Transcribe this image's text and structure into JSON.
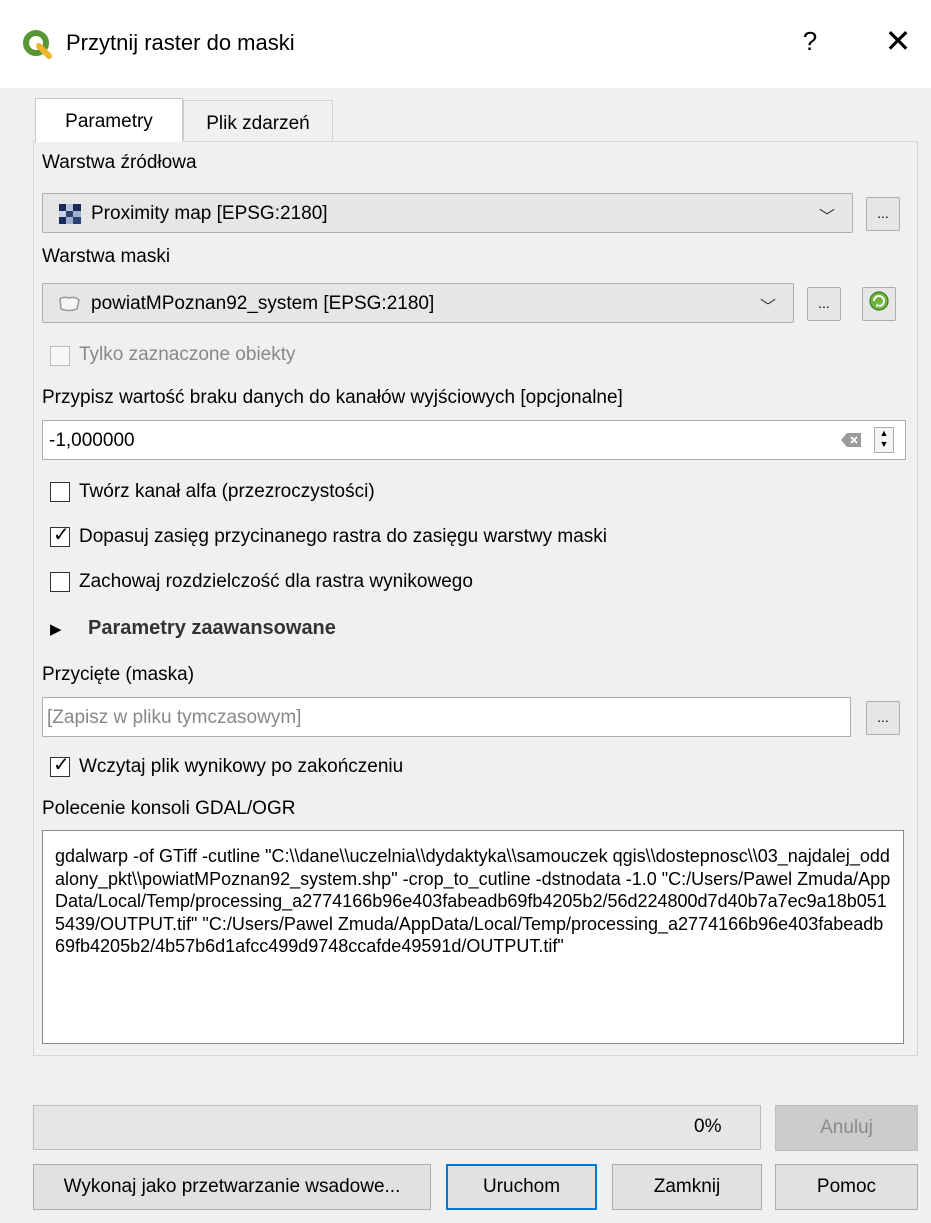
{
  "window": {
    "title": "Przytnij raster do maski",
    "help_label": "?",
    "close_label": "✕",
    "logo_icon": "qgis-logo-icon"
  },
  "tabs": [
    {
      "label": "Parametry",
      "active": true
    },
    {
      "label": "Plik zdarzeń",
      "active": false
    }
  ],
  "source_layer": {
    "label": "Warstwa źródłowa",
    "value": "Proximity map [EPSG:2180]",
    "icon": "raster-layer-icon",
    "browse_label": "..."
  },
  "mask_layer": {
    "label": "Warstwa maski",
    "value": "powiatMPoznan92_system [EPSG:2180]",
    "icon": "polygon-layer-icon",
    "browse_label": "...",
    "iterate_icon": "refresh-green-icon"
  },
  "selected_only": {
    "label": "Tylko zaznaczone obiekty",
    "checked": false,
    "enabled": false
  },
  "nodata": {
    "label": "Przypisz wartość braku danych do kanałów wyjściowych [opcjonalne]",
    "value": "-1,000000"
  },
  "options": [
    {
      "label": "Twórz kanał alfa (przezroczystości)",
      "checked": false
    },
    {
      "label": "Dopasuj zasięg przycinanego rastra do zasięgu warstwy maski",
      "checked": true
    },
    {
      "label": "Zachowaj rozdzielczość dla rastra wynikowego",
      "checked": false
    }
  ],
  "advanced": {
    "label": "Parametry zaawansowane"
  },
  "output": {
    "label": "Przycięte (maska)",
    "placeholder": "[Zapisz w pliku tymczasowym]",
    "browse_label": "..."
  },
  "open_output": {
    "label": "Wczytaj plik wynikowy po zakończeniu",
    "checked": true
  },
  "console": {
    "label": "Polecenie konsoli GDAL/OGR",
    "text": "gdalwarp -of GTiff -cutline \"C:\\\\dane\\\\uczelnia\\\\dydaktyka\\\\samouczek qgis\\\\dostepnosc\\\\03_najdalej_oddalony_pkt\\\\powiatMPoznan92_system.shp\" -crop_to_cutline -dstnodata -1.0 \"C:/Users/Pawel Zmuda/AppData/Local/Temp/processing_a2774166b96e403fabeadb69fb4205b2/56d224800d7d40b7a7ec9a18b0515439/OUTPUT.tif\" \"C:/Users/Pawel Zmuda/AppData/Local/Temp/processing_a2774166b96e403fabeadb69fb4205b2/4b57b6d1afcc499d9748ccafde49591d/OUTPUT.tif\""
  },
  "progress": {
    "value": 0,
    "text": "0%"
  },
  "buttons": {
    "cancel": "Anuluj",
    "batch": "Wykonaj jako przetwarzanie wsadowe...",
    "run": "Uruchom",
    "close": "Zamknij",
    "help": "Pomoc"
  },
  "colors": {
    "accent": "#0078d7",
    "qgis_green": "#589632",
    "qgis_yellow": "#ee7913"
  }
}
